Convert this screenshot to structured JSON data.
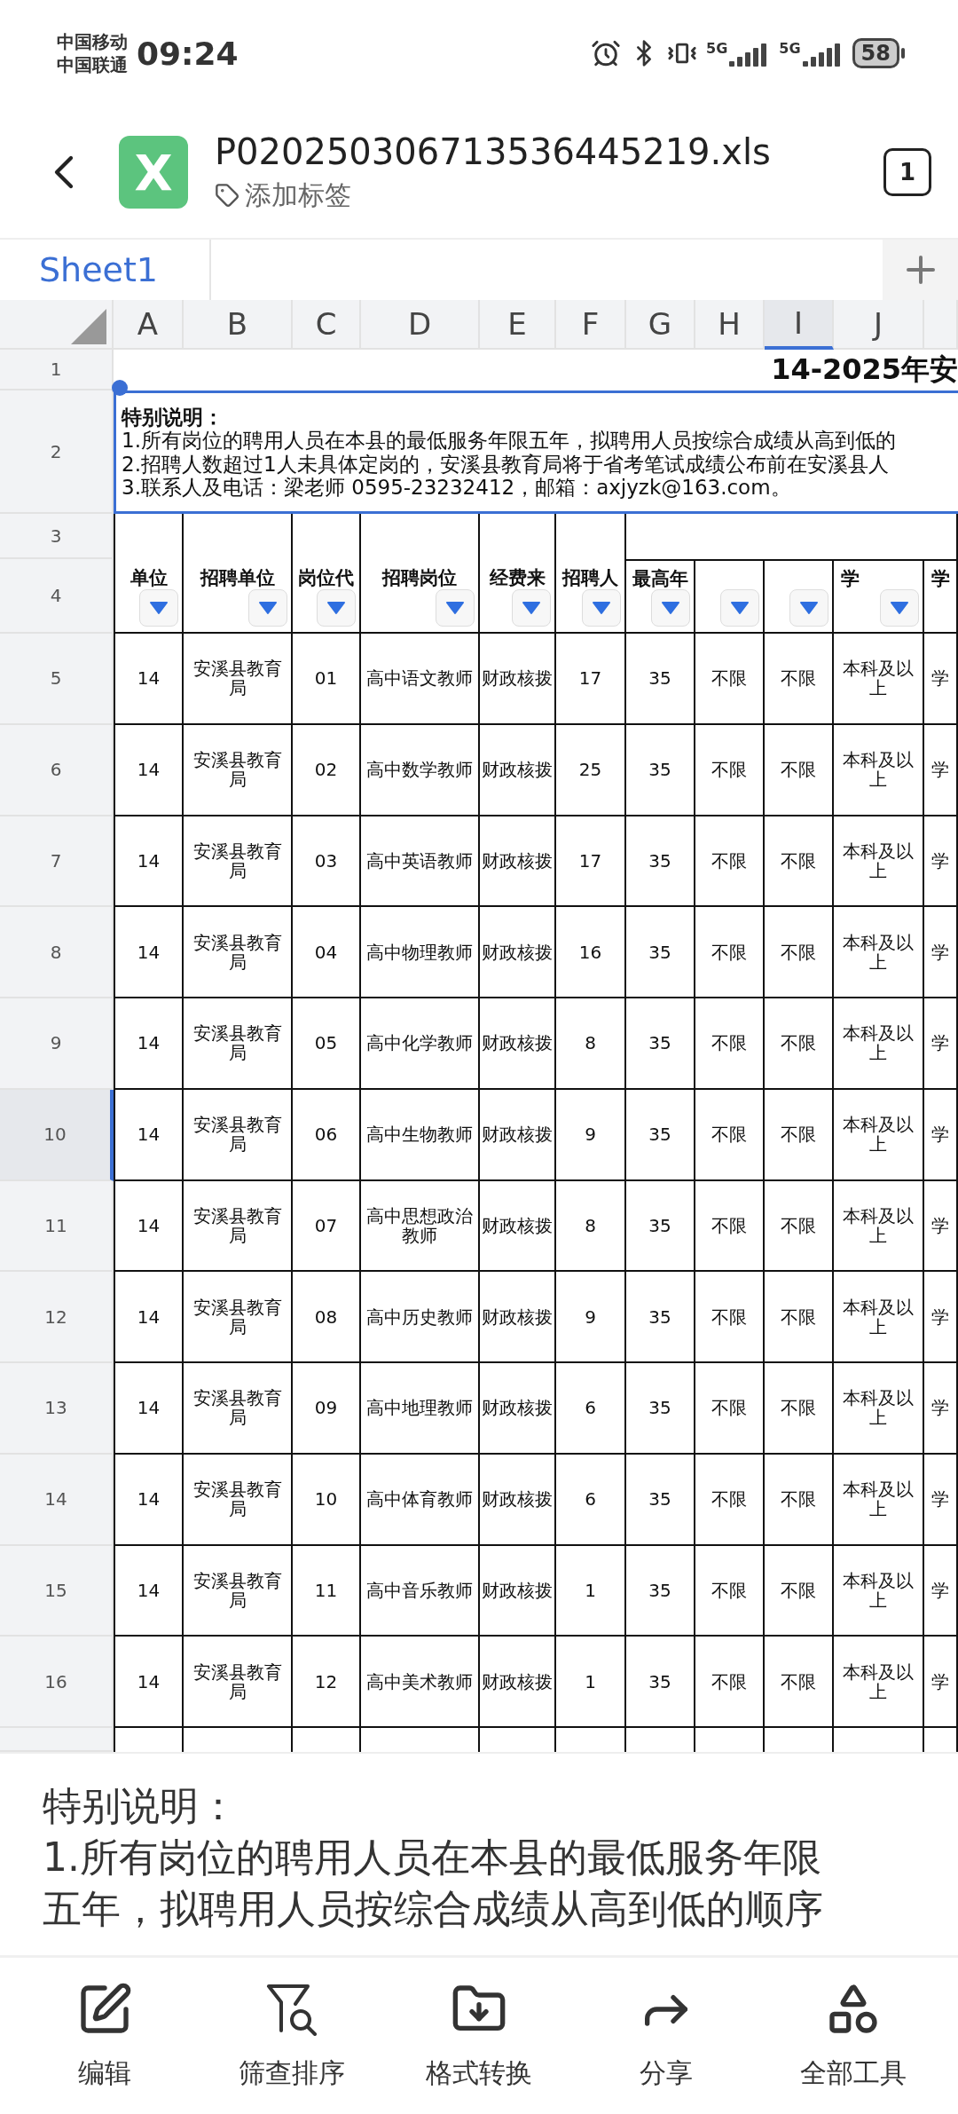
{
  "status_bar": {
    "carriers": [
      "中国移动",
      "中国联通"
    ],
    "time": "09:24",
    "networks": [
      "5G",
      "5G"
    ],
    "battery": "58"
  },
  "header": {
    "app_logo": "X",
    "filename": "P020250306713536445219.xls",
    "tag_label": "添加标签",
    "window_count": "1"
  },
  "sheet_tabs": [
    {
      "label": "Sheet1",
      "selected": true
    }
  ],
  "columns": [
    {
      "letter": "A",
      "selected": false
    },
    {
      "letter": "B",
      "selected": false
    },
    {
      "letter": "C",
      "selected": false
    },
    {
      "letter": "D",
      "selected": false
    },
    {
      "letter": "E",
      "selected": false
    },
    {
      "letter": "F",
      "selected": false
    },
    {
      "letter": "G",
      "selected": false
    },
    {
      "letter": "H",
      "selected": false
    },
    {
      "letter": "I",
      "selected": true
    },
    {
      "letter": "J",
      "selected": false
    }
  ],
  "title_row": {
    "number": "1",
    "text": "14-2025年安"
  },
  "notes_row": {
    "number": "2",
    "selected": true,
    "heading": "特别说明：",
    "lines": [
      "1.所有岗位的聘用人员在本县的最低服务年限五年，拟聘用人员按综合成绩从高到低的",
      "2.招聘人数超过1人未具体定岗的，安溪县教育局将于省考笔试成绩公布前在安溪县人",
      "3.联系人及电话：梁老师 0595-23232412，邮箱：axjyzk@163.com。"
    ]
  },
  "header_rows": {
    "numbers": [
      "3",
      "4"
    ],
    "cells": [
      {
        "text": "单位",
        "filter": true
      },
      {
        "text": "招聘单位",
        "filter": true
      },
      {
        "text": "岗位代",
        "filter": true
      },
      {
        "text": "招聘岗位",
        "filter": true
      },
      {
        "text": "经费来",
        "filter": true
      },
      {
        "text": "招聘人",
        "filter": true
      },
      {
        "text": "最高年",
        "filter": true
      },
      {
        "filter": true
      },
      {
        "filter": true
      },
      {
        "text": "学",
        "filter": true
      },
      {
        "text": "学",
        "filter": false
      }
    ]
  },
  "rows": [
    {
      "number": "5",
      "selected": false,
      "cells": [
        "14",
        "安溪县教育局",
        "01",
        "高中语文教师",
        "财政核拨",
        "17",
        "35",
        "不限",
        "不限",
        "本科及以上",
        "学"
      ]
    },
    {
      "number": "6",
      "selected": false,
      "cells": [
        "14",
        "安溪县教育局",
        "02",
        "高中数学教师",
        "财政核拨",
        "25",
        "35",
        "不限",
        "不限",
        "本科及以上",
        "学"
      ]
    },
    {
      "number": "7",
      "selected": false,
      "cells": [
        "14",
        "安溪县教育局",
        "03",
        "高中英语教师",
        "财政核拨",
        "17",
        "35",
        "不限",
        "不限",
        "本科及以上",
        "学"
      ]
    },
    {
      "number": "8",
      "selected": false,
      "cells": [
        "14",
        "安溪县教育局",
        "04",
        "高中物理教师",
        "财政核拨",
        "16",
        "35",
        "不限",
        "不限",
        "本科及以上",
        "学"
      ]
    },
    {
      "number": "9",
      "selected": false,
      "cells": [
        "14",
        "安溪县教育局",
        "05",
        "高中化学教师",
        "财政核拨",
        "8",
        "35",
        "不限",
        "不限",
        "本科及以上",
        "学"
      ]
    },
    {
      "number": "10",
      "selected": true,
      "cells": [
        "14",
        "安溪县教育局",
        "06",
        "高中生物教师",
        "财政核拨",
        "9",
        "35",
        "不限",
        "不限",
        "本科及以上",
        "学"
      ]
    },
    {
      "number": "11",
      "selected": false,
      "cells": [
        "14",
        "安溪县教育局",
        "07",
        "高中思想政治教师",
        "财政核拨",
        "8",
        "35",
        "不限",
        "不限",
        "本科及以上",
        "学"
      ]
    },
    {
      "number": "12",
      "selected": false,
      "cells": [
        "14",
        "安溪县教育局",
        "08",
        "高中历史教师",
        "财政核拨",
        "9",
        "35",
        "不限",
        "不限",
        "本科及以上",
        "学"
      ]
    },
    {
      "number": "13",
      "selected": false,
      "cells": [
        "14",
        "安溪县教育局",
        "09",
        "高中地理教师",
        "财政核拨",
        "6",
        "35",
        "不限",
        "不限",
        "本科及以上",
        "学"
      ]
    },
    {
      "number": "14",
      "selected": false,
      "cells": [
        "14",
        "安溪县教育局",
        "10",
        "高中体育教师",
        "财政核拨",
        "6",
        "35",
        "不限",
        "不限",
        "本科及以上",
        "学"
      ]
    },
    {
      "number": "15",
      "selected": false,
      "cells": [
        "14",
        "安溪县教育局",
        "11",
        "高中音乐教师",
        "财政核拨",
        "1",
        "35",
        "不限",
        "不限",
        "本科及以上",
        "学"
      ]
    },
    {
      "number": "16",
      "selected": false,
      "cells": [
        "14",
        "安溪县教育局",
        "12",
        "高中美术教师",
        "财政核拨",
        "1",
        "35",
        "不限",
        "不限",
        "本科及以上",
        "学"
      ]
    }
  ],
  "cell_preview": {
    "heading": "特别说明：",
    "text": "1.所有岗位的聘用人员在本县的最低服务年限五年，拟聘用人员按综合成绩从高到低的顺序"
  },
  "toolbar": [
    {
      "kind": "edit",
      "label": "编辑"
    },
    {
      "kind": "filter",
      "label": "筛查排序"
    },
    {
      "kind": "convert",
      "label": "格式转换"
    },
    {
      "kind": "share",
      "label": "分享"
    },
    {
      "kind": "tools",
      "label": "全部工具"
    }
  ]
}
